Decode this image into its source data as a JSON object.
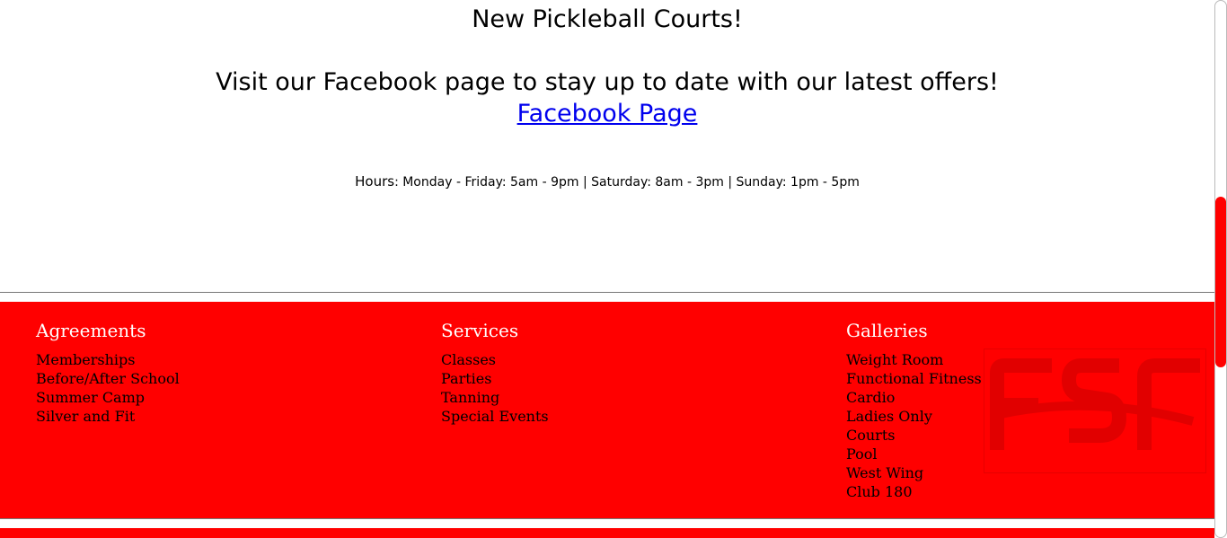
{
  "announcement": {
    "headline": "New Pickleball Courts!",
    "facebook_text": "Visit our Facebook page to stay up to date with our latest offers!",
    "facebook_link": "Facebook Page"
  },
  "hours": {
    "label": "Hours",
    "text": ": Monday - Friday: 5am - 9pm | Saturday: 8am - 3pm | Sunday: 1pm - 5pm"
  },
  "footer": {
    "columns": [
      {
        "title": "Agreements",
        "links": [
          "Memberships",
          "Before/After School",
          "Summer Camp",
          "Silver and Fit"
        ]
      },
      {
        "title": "Services",
        "links": [
          "Classes",
          "Parties",
          "Tanning",
          "Special Events"
        ]
      },
      {
        "title": "Galleries",
        "links": [
          "Weight Room",
          "Functional Fitness",
          "Cardio",
          "Ladies Only",
          "Courts",
          "Pool",
          "West Wing",
          "Club 180"
        ]
      }
    ],
    "logo_text": "FSF"
  },
  "colors": {
    "accent": "#ff0000",
    "link": "#0000ee",
    "heading": "#ffffff"
  },
  "icons": {
    "logo": "fsf-logo-watermark"
  }
}
